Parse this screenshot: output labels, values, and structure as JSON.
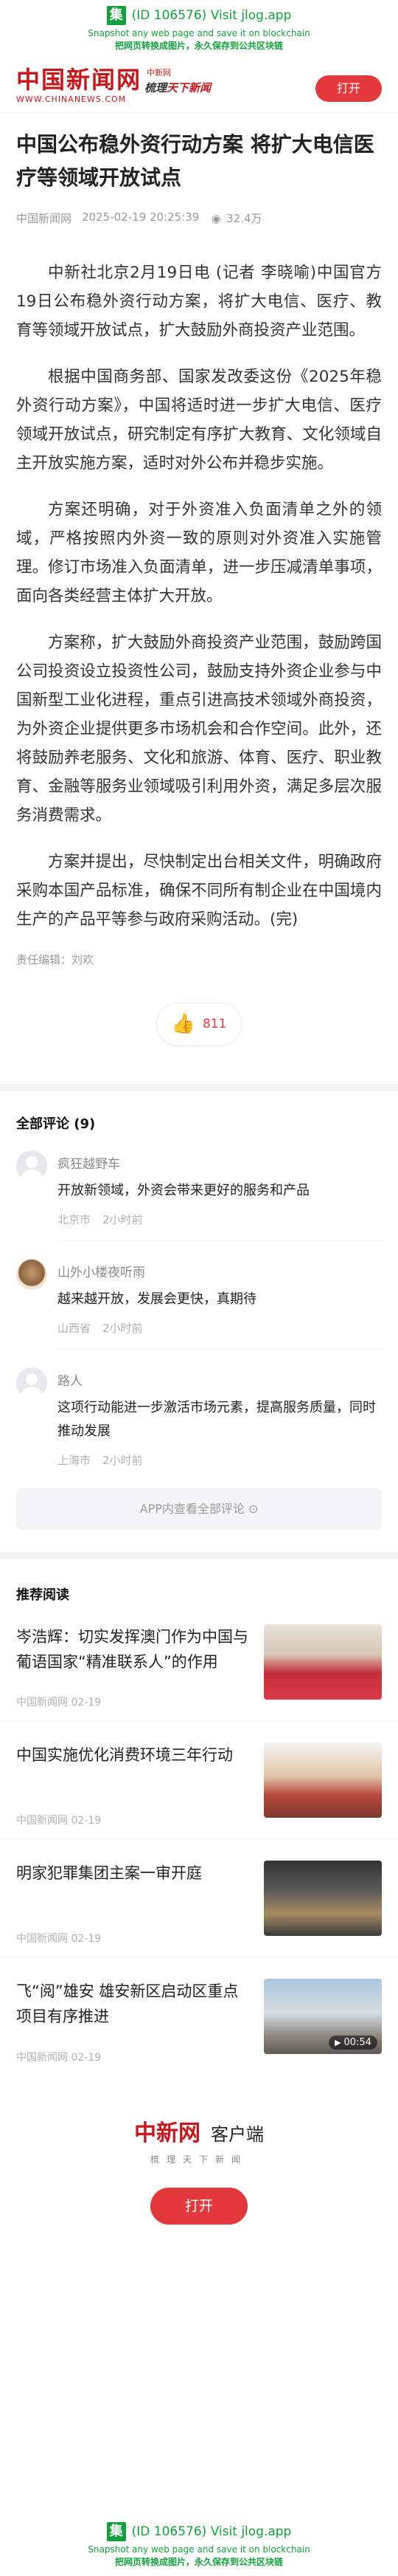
{
  "jlog": {
    "logo_char": "集",
    "main": "(ID 106576) Visit jlog.app",
    "sub1": "Snapshot any web page and save it on blockchain",
    "sub2": "把网页转换成图片，永久保存到公共区块链"
  },
  "header": {
    "brand_cn": "中国新闻网",
    "brand_tag": "中新网",
    "brand_en": "WWW.CHINANEWS.COM",
    "slogan_prefix": "梳理",
    "slogan_suffix": "天下新闻",
    "open_label": "打开"
  },
  "article": {
    "title": "中国公布稳外资行动方案 将扩大电信医疗等领域开放试点",
    "source": "中国新闻网",
    "datetime": "2025-02-19 20:25:39",
    "views": "32.4万",
    "paragraphs": [
      "中新社北京2月19日电 (记者 李晓喻)中国官方19日公布稳外资行动方案，将扩大电信、医疗、教育等领域开放试点，扩大鼓励外商投资产业范围。",
      "根据中国商务部、国家发改委这份《2025年稳外资行动方案》，中国将适时进一步扩大电信、医疗领域开放试点，研究制定有序扩大教育、文化领域自主开放实施方案，适时对外公布并稳步实施。",
      "方案还明确，对于外资准入负面清单之外的领域，严格按照内外资一致的原则对外资准入实施管理。修订市场准入负面清单，进一步压减清单事项，面向各类经营主体扩大开放。",
      "方案称，扩大鼓励外商投资产业范围，鼓励跨国公司投资设立投资性公司，鼓励支持外资企业参与中国新型工业化进程，重点引进高技术领域外商投资，为外资企业提供更多市场机会和合作空间。此外，还将鼓励养老服务、文化和旅游、体育、医疗、职业教育、金融等服务业领域吸引利用外资，满足多层次服务消费需求。",
      "方案并提出，尽快制定出台相关文件，明确政府采购本国产品标准，确保不同所有制企业在中国境内生产的产品平等参与政府采购活动。(完)"
    ],
    "editor": "责任编辑：刘欢",
    "likes": "811"
  },
  "comments": {
    "title": "全部评论 (9)",
    "items": [
      {
        "name": "疯狂越野车",
        "text": "开放新领域，外资会带来更好的服务和产品",
        "location": "北京市",
        "time": "2小时前"
      },
      {
        "name": "山外小楼夜听雨",
        "text": "越来越开放，发展会更快，真期待",
        "location": "山西省",
        "time": "2小时前"
      },
      {
        "name": "路人",
        "text": "这项行动能进一步激活市场元素，提高服务质量，同时推动发展",
        "location": "上海市",
        "time": "2小时前"
      }
    ],
    "app_link": "APP内查看全部评论 ⊙"
  },
  "recommended": {
    "title": "推荐阅读",
    "items": [
      {
        "headline": "岑浩辉：切实发挥澳门作为中国与葡语国家“精准联系人”的作用",
        "source": "中国新闻网",
        "date": "02-19"
      },
      {
        "headline": "中国实施优化消费环境三年行动",
        "source": "中国新闻网",
        "date": "02-19"
      },
      {
        "headline": "明家犯罪集团主案一审开庭",
        "source": "中国新闻网",
        "date": "02-19"
      },
      {
        "headline": "飞“阅”雄安 雄安新区启动区重点项目有序推进",
        "source": "中国新闻网",
        "date": "02-19",
        "duration": "00:54"
      }
    ]
  },
  "promo": {
    "brand_cn": "中新网",
    "client": "客户端",
    "sub": "梳理天下新闻",
    "open_label": "打开"
  }
}
